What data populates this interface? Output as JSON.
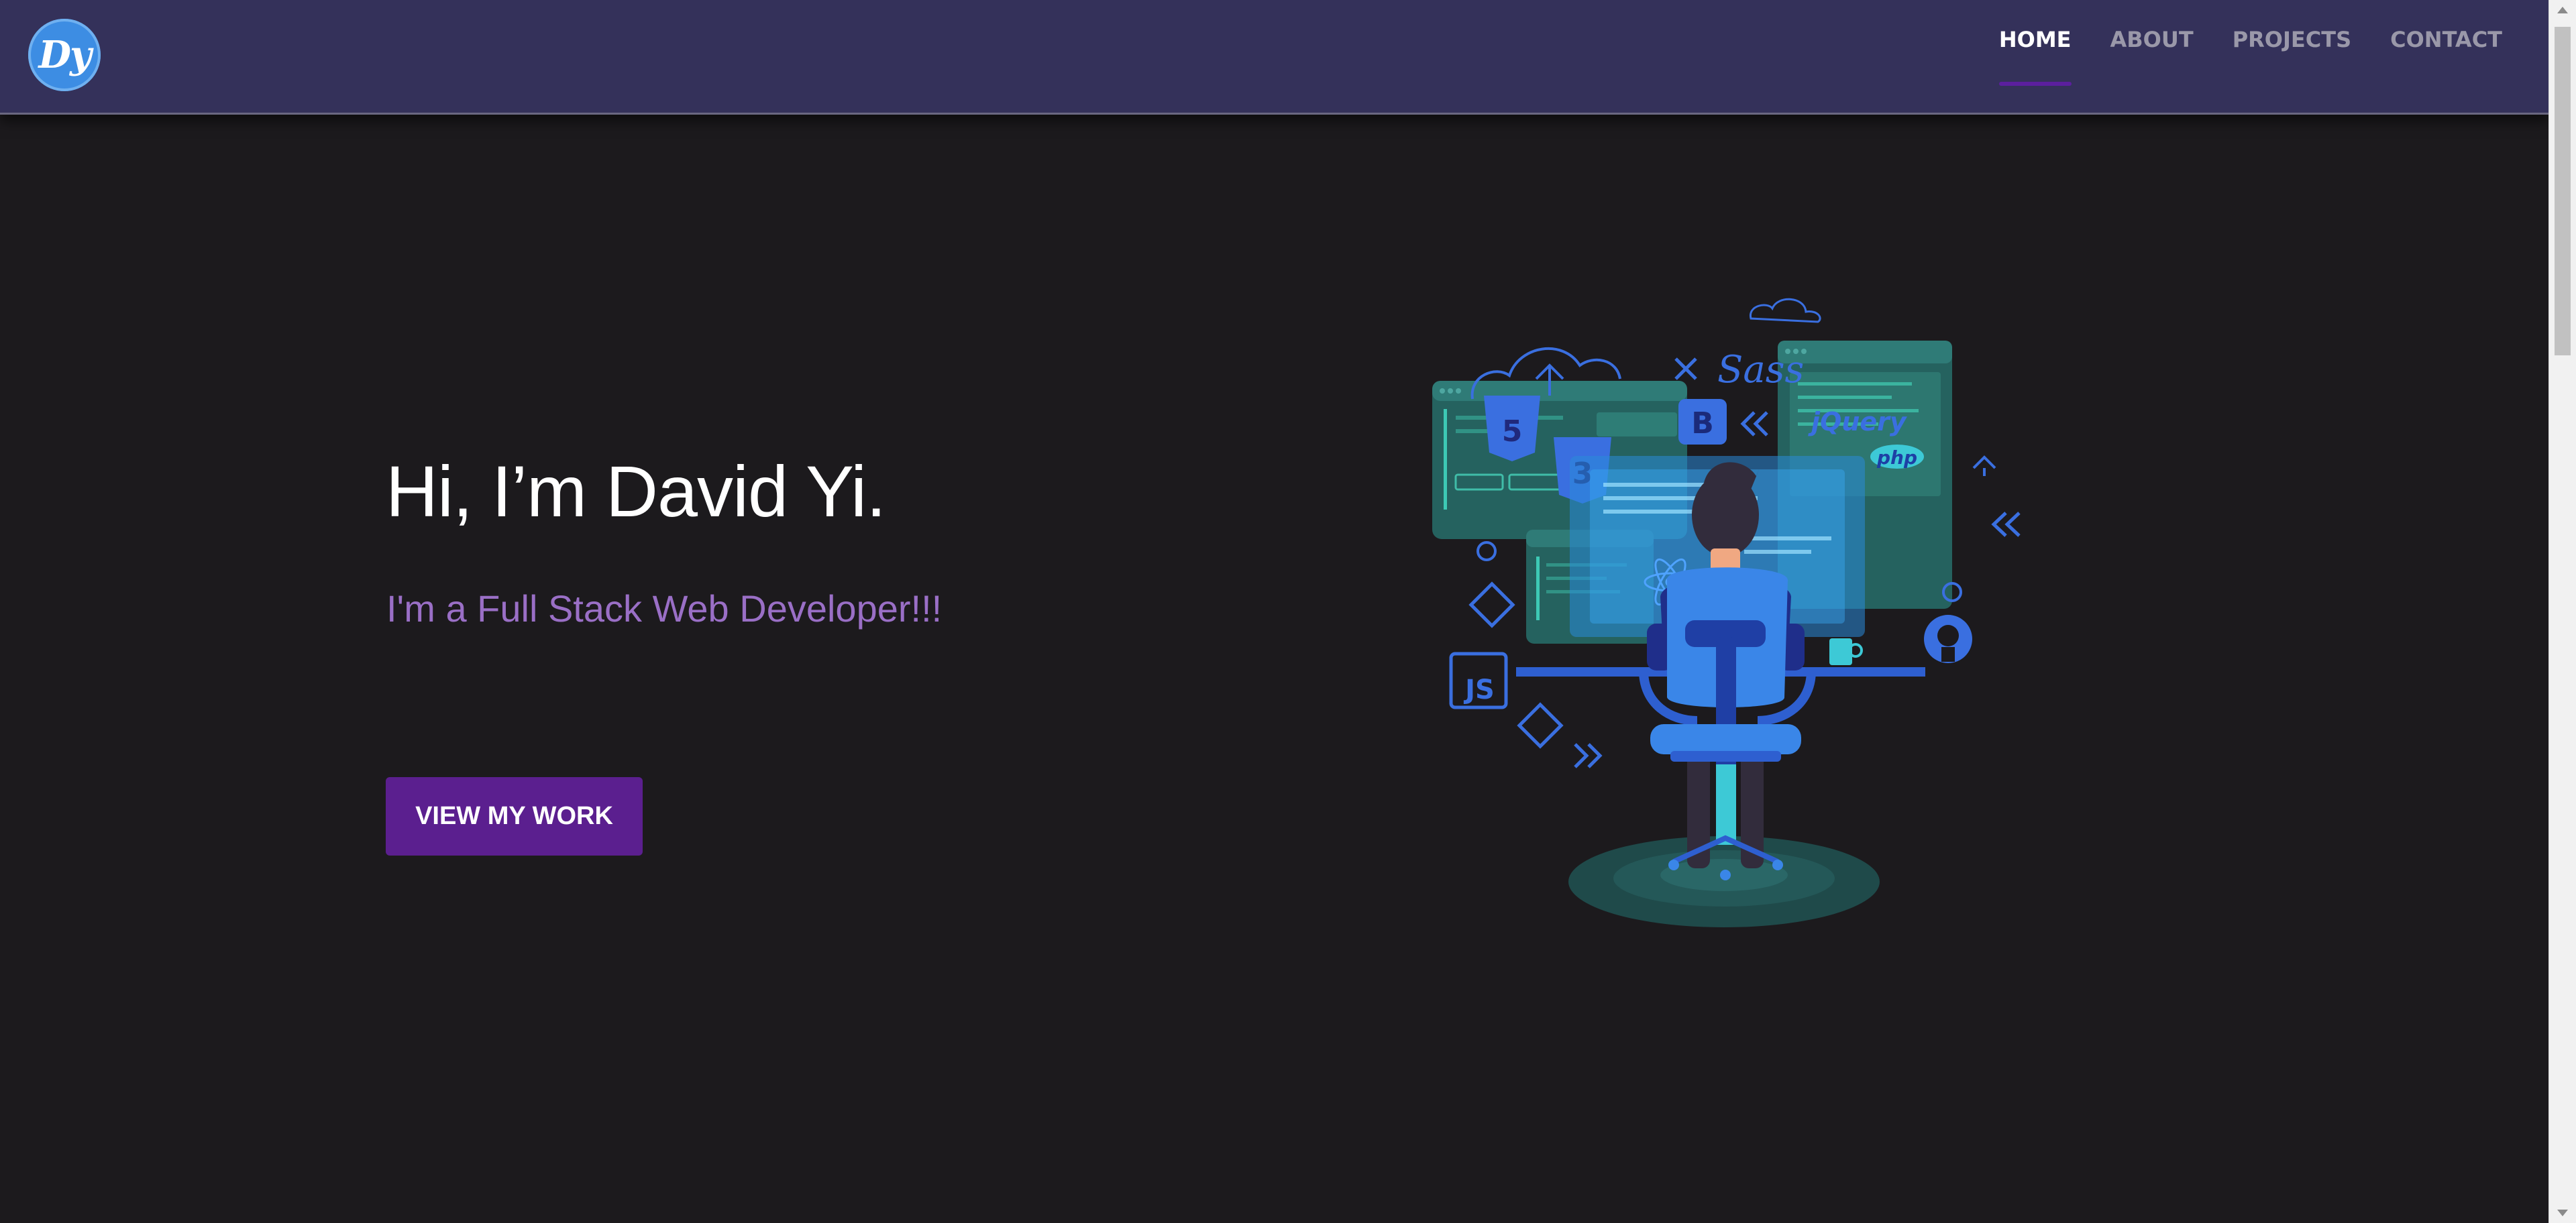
{
  "logo": {
    "text": "Dy"
  },
  "nav": {
    "items": [
      {
        "label": "HOME",
        "active": true
      },
      {
        "label": "ABOUT",
        "active": false
      },
      {
        "label": "PROJECTS",
        "active": false
      },
      {
        "label": "CONTACT",
        "active": false
      }
    ]
  },
  "hero": {
    "title": "Hi, I’m David Yi.",
    "subtitle": "I'm a Full Stack Web Developer!!!",
    "cta_label": "VIEW MY WORK"
  },
  "illustration": {
    "labels": {
      "sass": "Sass",
      "jquery": "jQuery",
      "php": "php",
      "js": "JS",
      "bootstrap": "B"
    }
  },
  "colors": {
    "background": "#1c1a1d",
    "navbar": "#34315a",
    "accent_purple": "#5b1f8f",
    "subtitle": "#9a6fc6",
    "illustration_blue": "#3a6fe0",
    "illustration_teal": "#2a6b6b"
  }
}
